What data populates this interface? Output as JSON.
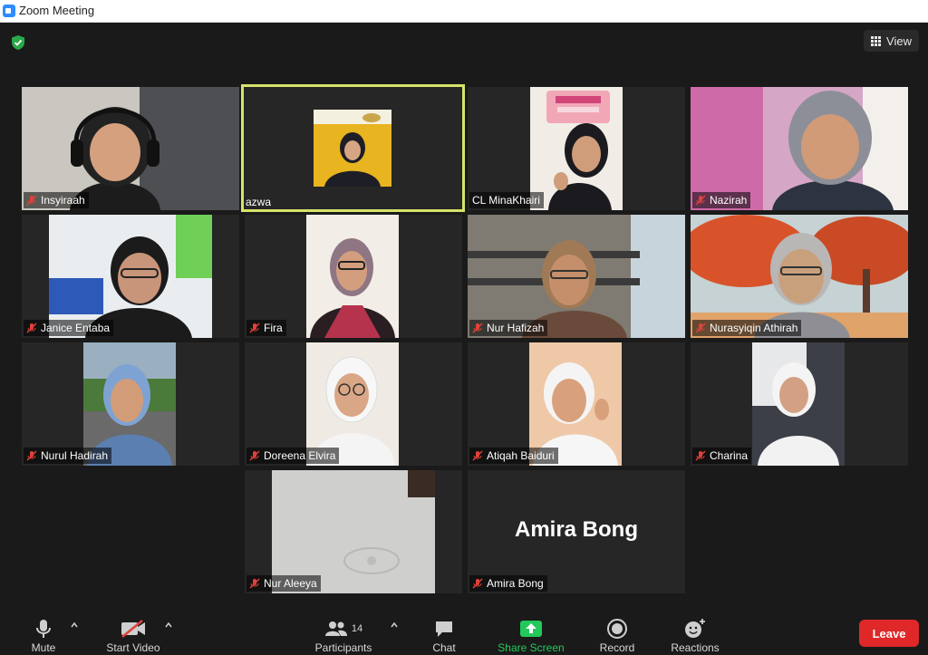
{
  "window": {
    "title": "Zoom Meeting"
  },
  "top": {
    "view_label": "View"
  },
  "tiles": [
    {
      "name": "Insyiraah",
      "muted": true
    },
    {
      "name": "azwa",
      "muted": false,
      "active": true
    },
    {
      "name": "CL MinaKhairi",
      "muted": false
    },
    {
      "name": "Nazirah",
      "muted": true
    },
    {
      "name": "Janice Entaba",
      "muted": true
    },
    {
      "name": "Fira",
      "muted": true
    },
    {
      "name": "Nur Hafizah",
      "muted": true
    },
    {
      "name": "Nurasyiqin Athirah",
      "muted": true
    },
    {
      "name": "Nurul Hadirah",
      "muted": true
    },
    {
      "name": "Doreena Elvira",
      "muted": true
    },
    {
      "name": "Atiqah Baiduri",
      "muted": true
    },
    {
      "name": "Charina",
      "muted": true
    },
    {
      "name": "Nur Aleeya",
      "muted": true
    },
    {
      "name": "Amira Bong",
      "muted": true,
      "display_name": "Amira Bong",
      "camera_off": true
    }
  ],
  "toolbar": {
    "mute_label": "Mute",
    "video_label": "Start Video",
    "participants_label": "Participants",
    "participants_count": "14",
    "chat_label": "Chat",
    "share_label": "Share Screen",
    "record_label": "Record",
    "reactions_label": "Reactions",
    "leave_label": "Leave"
  },
  "colors": {
    "accent_green": "#23c95a",
    "leave_red": "#e02828",
    "active_speaker": "#d7e36a",
    "muted_red": "#e0413a"
  }
}
